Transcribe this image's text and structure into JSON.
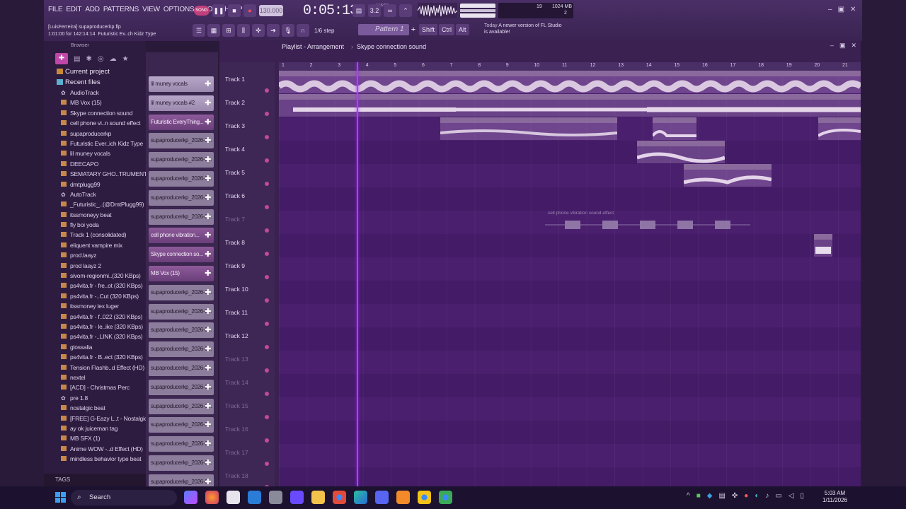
{
  "menus": [
    "FILE",
    "EDIT",
    "ADD",
    "PATTERNS",
    "VIEW",
    "OPTIONS",
    "TOOLS",
    "HELP"
  ],
  "project": {
    "user_file": "[LuisFerreira] supaproducerkp.flp",
    "time_info": "1:01:00 for 142:14:14",
    "hint": "Futuristic Ev..ch Kidz Type"
  },
  "transport": {
    "tempo": "130.000",
    "time": "0:05:13",
    "time_sub": "M:S:CS",
    "song_label": "SONG"
  },
  "cpu": {
    "value1": "19",
    "memory": "1024 MB",
    "value2": "2"
  },
  "toolbar": {
    "step": "1/6 step",
    "pattern": "Pattern 1",
    "shift": "Shift",
    "ctrl": "Ctrl",
    "alt": "Alt"
  },
  "news": {
    "today": "Today",
    "msg": "A newer version of FL Studio is available!"
  },
  "browser": {
    "title": "Browser",
    "sections": {
      "current_project": "Current project",
      "recent_files": "Recent files"
    },
    "items": [
      {
        "icon": "gear",
        "label": "AudioTrack"
      },
      {
        "icon": "audio",
        "label": "MB Vox (15)"
      },
      {
        "icon": "audio",
        "label": "Skype connection sound"
      },
      {
        "icon": "audio",
        "label": "cell phone vi..n sound effect"
      },
      {
        "icon": "audio",
        "label": "supaproducerkp"
      },
      {
        "icon": "audio",
        "label": "Futuristic Ever..ich Kidz Type"
      },
      {
        "icon": "audio",
        "label": "lil muney vocals"
      },
      {
        "icon": "audio",
        "label": "DEECAPO"
      },
      {
        "icon": "audio",
        "label": "SEMATARY GHO..TRUMENTAL"
      },
      {
        "icon": "audio",
        "label": "dmtplugg99"
      },
      {
        "icon": "gear",
        "label": "AutoTrack"
      },
      {
        "icon": "audio",
        "label": "_Futuristic_..(@DmtPlugg99)"
      },
      {
        "icon": "audio",
        "label": "itssmoneyy beat"
      },
      {
        "icon": "audio",
        "label": "fly boi yoda"
      },
      {
        "icon": "audio",
        "label": "Track 1 (consolidated)"
      },
      {
        "icon": "audio",
        "label": "eliquent vampire mix"
      },
      {
        "icon": "audio",
        "label": "prod.laayz"
      },
      {
        "icon": "audio",
        "label": "prod laayz 2"
      },
      {
        "icon": "audio",
        "label": "sivom-regionmi..(320 KBps)"
      },
      {
        "icon": "audio",
        "label": "ps4vita.fr - fre..ot (320 KBps)"
      },
      {
        "icon": "audio",
        "label": "ps4vita.fr -..Cut (320 KBps)"
      },
      {
        "icon": "audio",
        "label": "itssmoney lex luger"
      },
      {
        "icon": "audio",
        "label": "ps4vita.fr - f..022 (320 KBps)"
      },
      {
        "icon": "audio",
        "label": "ps4vita.fr - le..ike (320 KBps)"
      },
      {
        "icon": "audio",
        "label": "ps4vita.fr -..LINK (320 KBps)"
      },
      {
        "icon": "audio",
        "label": "glossalia"
      },
      {
        "icon": "audio",
        "label": "ps4vita.fr - B..ect (320 KBps)"
      },
      {
        "icon": "audio",
        "label": "Tension Flashb..d Effect (HD)"
      },
      {
        "icon": "audio",
        "label": "nextel"
      },
      {
        "icon": "audio",
        "label": "[ACD] - Christmas Perc"
      },
      {
        "icon": "gear",
        "label": "pre 1.8"
      },
      {
        "icon": "audio",
        "label": "nostalgic beat"
      },
      {
        "icon": "audio",
        "label": "[FREE] G-Eazy L..t - Nostalgic"
      },
      {
        "icon": "audio",
        "label": "ay ok juiceman tag"
      },
      {
        "icon": "audio",
        "label": "MB SFX (1)"
      },
      {
        "icon": "audio",
        "label": "Anime WOW -..d Effect (HD)"
      },
      {
        "icon": "audio",
        "label": "mindless behavior type beat"
      }
    ],
    "tags": "TAGS"
  },
  "clips": [
    {
      "label": "lil muney vocals",
      "style": "audio"
    },
    {
      "label": "lil muney vocals #2",
      "style": "audio"
    },
    {
      "label": "Futuristic EveryThing...",
      "style": "ac"
    },
    {
      "label": "supaproducerkp_2026-0...",
      "style": "normal"
    },
    {
      "label": "supaproducerkp_2026-0...",
      "style": "normal"
    },
    {
      "label": "supaproducerkp_2026-0...",
      "style": "normal"
    },
    {
      "label": "supaproducerkp_2026-0...",
      "style": "normal"
    },
    {
      "label": "supaproducerkp_2026-0...",
      "style": "normal"
    },
    {
      "label": "cell phone vibration...",
      "style": "ac"
    },
    {
      "label": "Skype connection so...",
      "style": "ac"
    },
    {
      "label": "MB Vox (15)",
      "style": "ac"
    },
    {
      "label": "supaproducerkp_2026-0...",
      "style": "normal"
    },
    {
      "label": "supaproducerkp_2026-0...",
      "style": "normal"
    },
    {
      "label": "supaproducerkp_2026-0...",
      "style": "normal"
    },
    {
      "label": "supaproducerkp_2026-0...",
      "style": "normal"
    },
    {
      "label": "supaproducerkp_2026-0...",
      "style": "normal"
    },
    {
      "label": "supaproducerkp_2026-0...",
      "style": "normal"
    },
    {
      "label": "supaproducerkp_2026-0...",
      "style": "normal"
    },
    {
      "label": "supaproducerkp_2026-0...",
      "style": "normal"
    },
    {
      "label": "supaproducerkp_2026-0...",
      "style": "normal"
    },
    {
      "label": "supaproducerkp_2026-0...",
      "style": "normal"
    },
    {
      "label": "supaproducerkp_2026-0...",
      "style": "normal"
    }
  ],
  "playlist": {
    "title": "Playlist - Arrangement",
    "current": "Skype connection sound",
    "tracks": [
      "Track 1",
      "Track 2",
      "Track 3",
      "Track 4",
      "Track 5",
      "Track 6",
      "Track 7",
      "Track 8",
      "Track 9",
      "Track 10",
      "Track 11",
      "Track 12",
      "Track 13",
      "Track 14",
      "Track 15",
      "Track 16",
      "Track 17",
      "Track 18"
    ],
    "ruler": [
      "1",
      "2",
      "3",
      "4",
      "5",
      "6",
      "7",
      "8",
      "9",
      "10",
      "11",
      "12",
      "13",
      "14",
      "15",
      "16",
      "17",
      "18",
      "19",
      "20",
      "21"
    ],
    "clip_labels": {
      "futuristic": "Futuristic EveryThing Rich Kidz Type",
      "muney1": "lil muney vocals",
      "muney2": "lil muney vocals",
      "muney3": "lil muney vocals",
      "mbvox": "MB Vox (15)",
      "supa36": "supapro..36_REC",
      "supa_r": "supa..REC",
      "supa2": "supaproducerkp_2..11 02-14-57_REC",
      "supa3": "supaproduc..16-30_REC",
      "supa3b": "supa..#2",
      "cell": "cell phone vibration sound effect",
      "skype": "S..ct"
    }
  },
  "taskbar": {
    "search": "Search",
    "time": "5:03 AM",
    "date": "1/11/2026"
  },
  "colors": {
    "accent": "#c046a8",
    "playhead": "#b040ff",
    "lane": "#4a1f6e"
  }
}
